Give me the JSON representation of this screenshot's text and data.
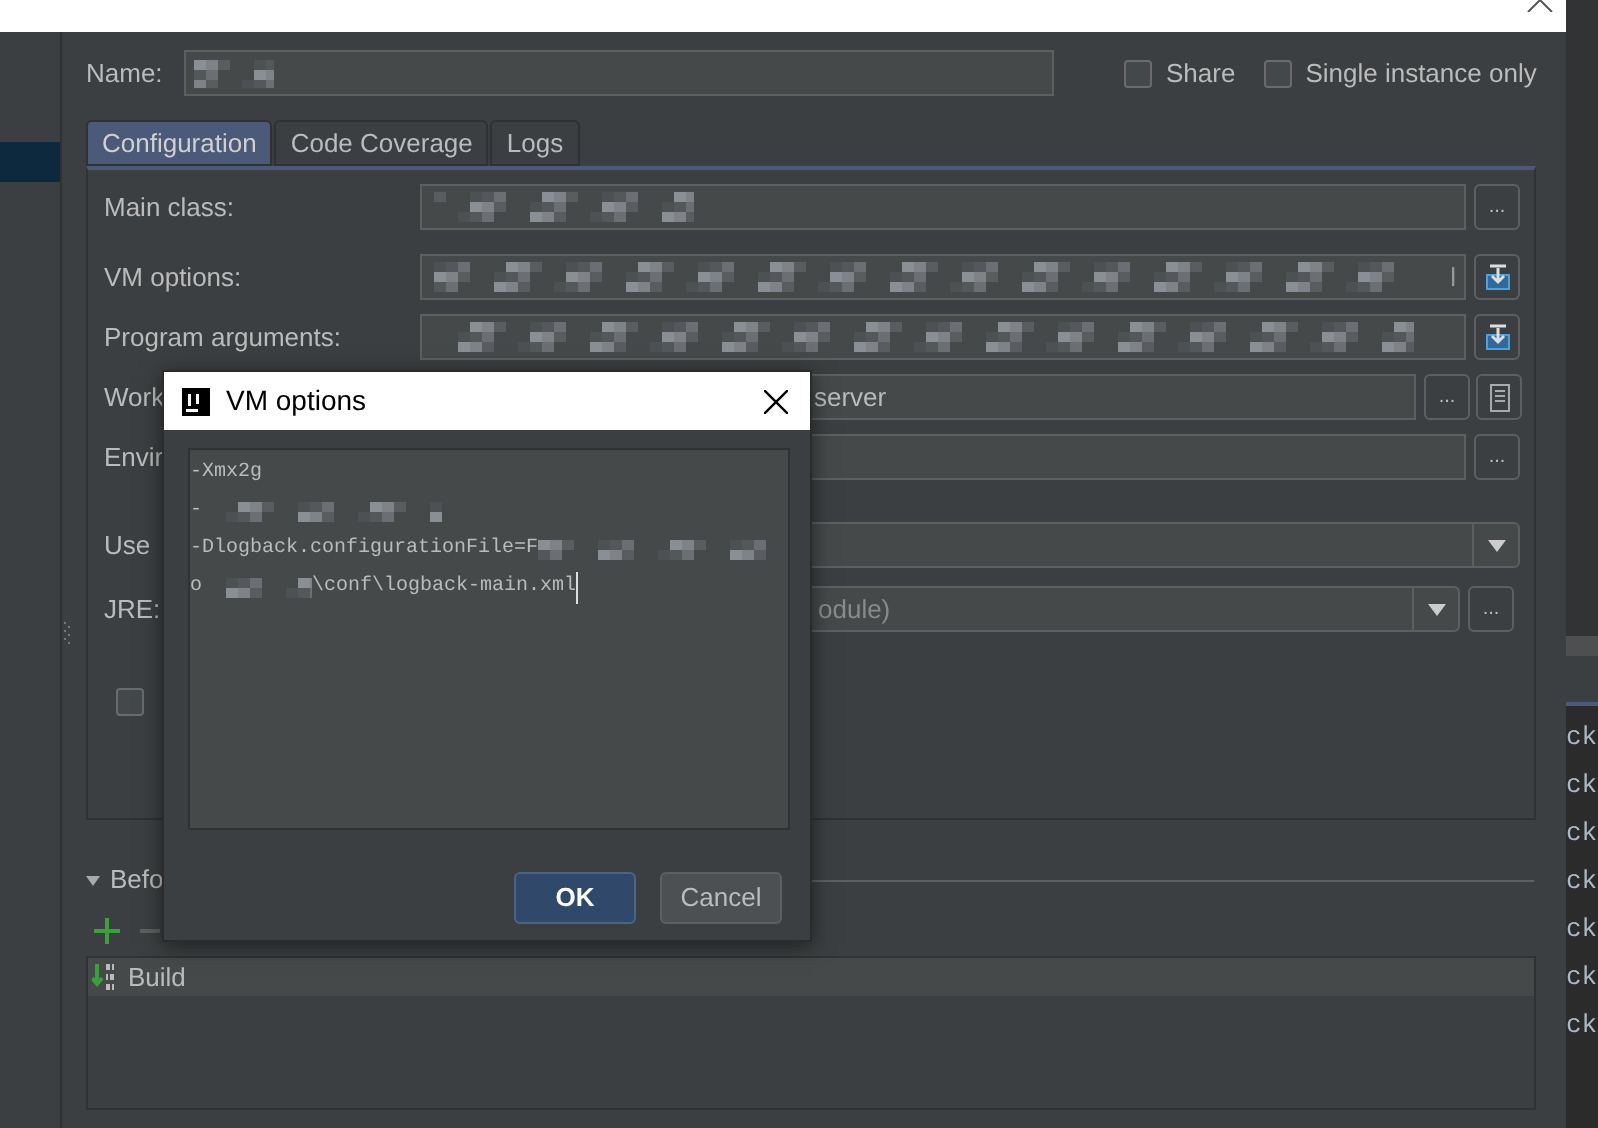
{
  "name_field": {
    "label": "Name:"
  },
  "options": [
    {
      "label": "Share",
      "checked": false
    },
    {
      "label": "Single instance only",
      "checked": false
    }
  ],
  "tabs": [
    {
      "label": "Configuration",
      "selected": true
    },
    {
      "label": "Code Coverage",
      "selected": false
    },
    {
      "label": "Logs",
      "selected": false
    }
  ],
  "form_rows": [
    {
      "kind": "text",
      "label": "Main class:",
      "value": "",
      "blurred": true,
      "buttons": [
        {
          "kind": "browse",
          "label": "..."
        }
      ]
    },
    {
      "kind": "text",
      "label": "VM options:",
      "value": "l",
      "blurred": true,
      "buttons": [
        {
          "kind": "expand"
        }
      ]
    },
    {
      "kind": "text",
      "label": "Program arguments:",
      "value": "",
      "blurred": true,
      "buttons": [
        {
          "kind": "expand"
        }
      ]
    },
    {
      "kind": "text",
      "label": "Work",
      "value": "server",
      "buttons": [
        {
          "kind": "browse",
          "label": "..."
        },
        {
          "kind": "macro"
        }
      ]
    },
    {
      "kind": "text",
      "label": "Envir",
      "value": "",
      "buttons": [
        {
          "kind": "browse",
          "label": "..."
        }
      ]
    },
    {
      "kind": "combo",
      "label": "Use",
      "value": "",
      "buttons": []
    },
    {
      "kind": "combo",
      "label": "JRE:",
      "value": "odule)",
      "buttons": [
        {
          "kind": "browse",
          "label": "..."
        }
      ]
    },
    {
      "kind": "checkbox",
      "checked": false
    }
  ],
  "before_launch": {
    "label": "Befo",
    "expanded": true,
    "tasks": [
      {
        "label": "Build",
        "selected": true
      }
    ]
  },
  "editor_fragments": [
    "ck",
    "ck",
    "ck",
    "ck",
    "ck",
    "ck",
    "ck"
  ],
  "dialog": {
    "title": "VM options",
    "lines": [
      [
        {
          "kind": "text",
          "text": "-Xmx2g"
        }
      ],
      [
        {
          "kind": "text",
          "text": "-"
        },
        {
          "kind": "blur"
        }
      ],
      [
        {
          "kind": "text",
          "text": "-Dlogback.configurationFile=F"
        },
        {
          "kind": "blur"
        }
      ],
      [
        {
          "kind": "text",
          "text": "o"
        },
        {
          "kind": "blur"
        },
        {
          "kind": "text",
          "text": "\\conf\\logback-main.xml"
        },
        {
          "kind": "caret"
        }
      ]
    ],
    "buttons": [
      {
        "label": "OK",
        "default": true
      },
      {
        "label": "Cancel",
        "default": false
      }
    ]
  }
}
